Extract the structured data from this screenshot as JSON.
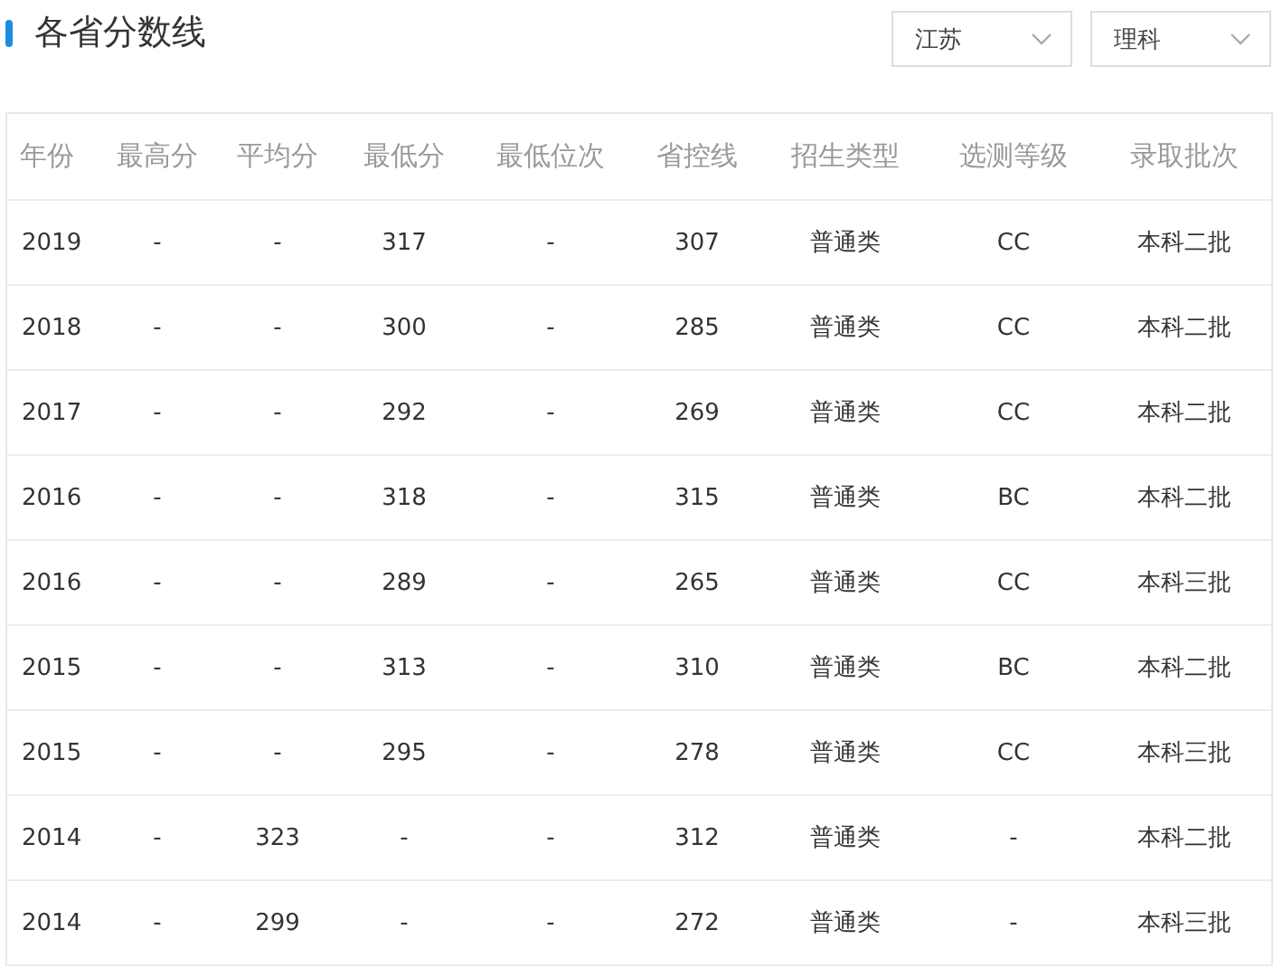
{
  "title": "各省分数线",
  "filters": [
    {
      "value": "江苏"
    },
    {
      "value": "理科"
    }
  ],
  "table": {
    "columns": [
      "年份",
      "最高分",
      "平均分",
      "最低分",
      "最低位次",
      "省控线",
      "招生类型",
      "选测等级",
      "录取批次"
    ],
    "rows": [
      [
        "2019",
        "-",
        "-",
        "317",
        "-",
        "307",
        "普通类",
        "CC",
        "本科二批"
      ],
      [
        "2018",
        "-",
        "-",
        "300",
        "-",
        "285",
        "普通类",
        "CC",
        "本科二批"
      ],
      [
        "2017",
        "-",
        "-",
        "292",
        "-",
        "269",
        "普通类",
        "CC",
        "本科二批"
      ],
      [
        "2016",
        "-",
        "-",
        "318",
        "-",
        "315",
        "普通类",
        "BC",
        "本科二批"
      ],
      [
        "2016",
        "-",
        "-",
        "289",
        "-",
        "265",
        "普通类",
        "CC",
        "本科三批"
      ],
      [
        "2015",
        "-",
        "-",
        "313",
        "-",
        "310",
        "普通类",
        "BC",
        "本科二批"
      ],
      [
        "2015",
        "-",
        "-",
        "295",
        "-",
        "278",
        "普通类",
        "CC",
        "本科三批"
      ],
      [
        "2014",
        "-",
        "323",
        "-",
        "-",
        "312",
        "普通类",
        "-",
        "本科二批"
      ],
      [
        "2014",
        "-",
        "299",
        "-",
        "-",
        "272",
        "普通类",
        "-",
        "本科三批"
      ]
    ]
  }
}
